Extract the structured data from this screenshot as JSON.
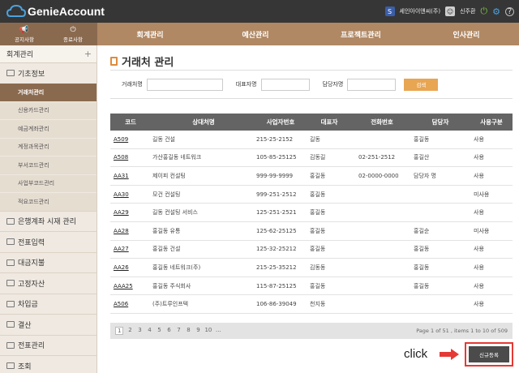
{
  "app": {
    "logo": "GenieAccount",
    "company": "세인아이앤씨(주)",
    "user": "신주환"
  },
  "quick": [
    {
      "label": "공지사항",
      "icon": "megaphone-icon"
    },
    {
      "label": "종료사항",
      "icon": "power-icon"
    }
  ],
  "nav": [
    "회계관리",
    "예산관리",
    "프로젝트관리",
    "인사관리"
  ],
  "sidebar": {
    "title": "회계관리",
    "plus": "+",
    "group": "기초정보",
    "subs": [
      "거래처관리",
      "신용카드관리",
      "예금계좌관리",
      "계정과목관리",
      "부서코드관리",
      "사업부코드관리",
      "적요코드관리"
    ],
    "active_sub": 0,
    "mains": [
      "은행계좌 시재 관리",
      "전표입력",
      "대금지불",
      "고정자산",
      "차입금",
      "결산",
      "전표관리",
      "조회"
    ]
  },
  "page": {
    "title": "거래처 관리"
  },
  "search": {
    "name_label": "거래처명",
    "rep_label": "대표자명",
    "mgr_label": "담당자명",
    "button": "검색"
  },
  "table": {
    "headers": [
      "코드",
      "상대처명",
      "사업자번호",
      "대표자",
      "전화번호",
      "담당자",
      "사용구분"
    ],
    "rows": [
      [
        "A509",
        "길동 건설",
        "215-25-2152",
        "길동",
        "",
        "홍길동",
        "사용"
      ],
      [
        "A508",
        "가산홍길동 네트워크",
        "105-85-25125",
        "김동길",
        "02-251-2512",
        "홍길산",
        "사용"
      ],
      [
        "AA31",
        "제이피 컨설팅",
        "999-99-9999",
        "홍길동",
        "02-0000-0000",
        "담당자 명",
        "사용"
      ],
      [
        "AA30",
        "모건 컨설팅",
        "999-251-2512",
        "홍길동",
        "",
        "",
        "미사용"
      ],
      [
        "AA29",
        "길동 컨설팅 서비스",
        "125-251-2521",
        "홍길동",
        "",
        "",
        "사용"
      ],
      [
        "AA28",
        "홍길동 유통",
        "125-62-25125",
        "홍길동",
        "",
        "홍길순",
        "미사용"
      ],
      [
        "AA27",
        "홍길동 건설",
        "125-32-25212",
        "홍길동",
        "",
        "홍길동",
        "사용"
      ],
      [
        "AA26",
        "홍길동 네트워크(주)",
        "215-25-35212",
        "김동동",
        "",
        "홍길동",
        "사용"
      ],
      [
        "AAA25",
        "홍길동 주식회사",
        "115-87-25125",
        "홍길동",
        "",
        "홍길동",
        "사용"
      ],
      [
        "A506",
        "(주)트루인프텍",
        "106-86-39049",
        "천지동",
        "",
        "",
        "사용"
      ]
    ]
  },
  "pager": {
    "pages": [
      "1",
      "2",
      "3",
      "4",
      "5",
      "6",
      "7",
      "8",
      "9",
      "10",
      "..."
    ],
    "info": "Page 1 of 51 , items 1 to 10 of 509"
  },
  "cta": {
    "click": "click",
    "new_button": "신규등록"
  }
}
